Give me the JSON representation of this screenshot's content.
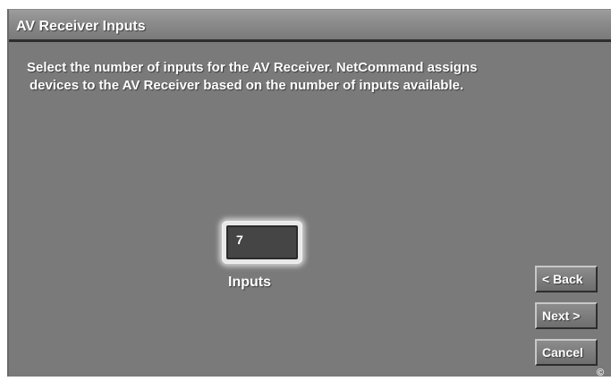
{
  "window": {
    "title": "AV Receiver Inputs"
  },
  "instructions": {
    "line1": "Select the number of inputs for the AV Receiver.  NetCommand assigns",
    "line2": "devices to the AV Receiver based on the number of inputs available."
  },
  "inputs": {
    "value": "7",
    "label": "Inputs"
  },
  "buttons": {
    "back": "< Back",
    "next": "Next >",
    "cancel": "Cancel"
  },
  "footer": {
    "copyright": "©"
  },
  "colors": {
    "panel": "#7a7a7a",
    "title_bar": "#8c8c8c",
    "text": "#ffffff",
    "input_field": "#454545"
  }
}
